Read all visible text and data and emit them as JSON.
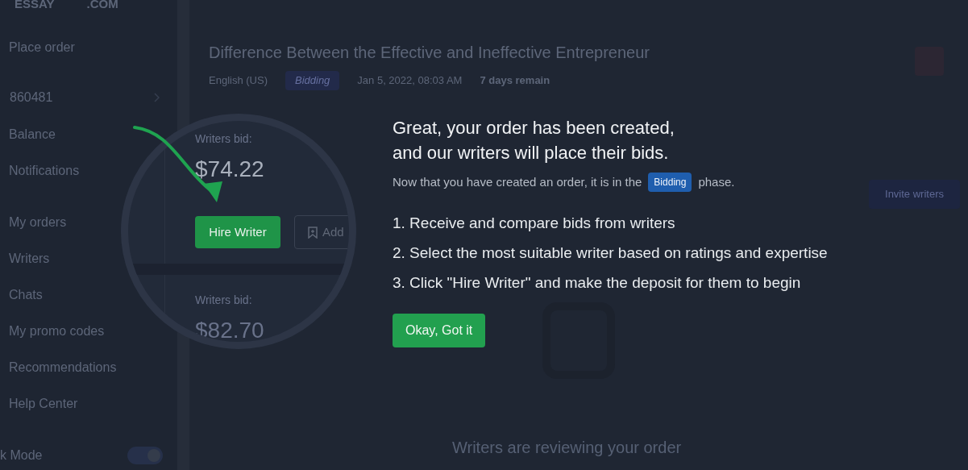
{
  "sidebar": {
    "logo": [
      "ESSAY",
      ".COM"
    ],
    "place_order": "Place order",
    "account_id": "860481",
    "items": [
      "Balance",
      "Notifications"
    ],
    "nav": [
      "My orders",
      "Writers",
      "Chats",
      "My promo codes",
      "Recommendations",
      "Help Center"
    ],
    "dark_mode": {
      "label": "k Mode",
      "on": true
    }
  },
  "order": {
    "title": "Difference Between the Effective and Ineffective Entrepreneur",
    "language": "English (US)",
    "status": "Bidding",
    "date": "Jan 5, 2022, 08:03 AM",
    "time_left": "7 days remain"
  },
  "invite_button": "Invite writers",
  "empty_state": "Writers are reviewing your order",
  "spotlight": {
    "bids": [
      {
        "label": "Writers bid:",
        "amount": "$74.22"
      },
      {
        "label": "Writers bid:",
        "amount": "$82.70"
      }
    ],
    "hire_button": "Hire Writer",
    "add_button": "Add"
  },
  "modal": {
    "title": [
      "Great, your order has been created,",
      "and our writers will place their bids."
    ],
    "intro": {
      "before": "Now that you have created an order, it is in the",
      "badge": "Bidding",
      "after": "phase."
    },
    "steps": [
      "1. Receive and compare bids from writers",
      "2. Select the most suitable writer based on ratings and expertise",
      "3. Click \"Hire Writer\" and make the deposit for them to begin"
    ],
    "ok_button": "Okay, Got it"
  }
}
